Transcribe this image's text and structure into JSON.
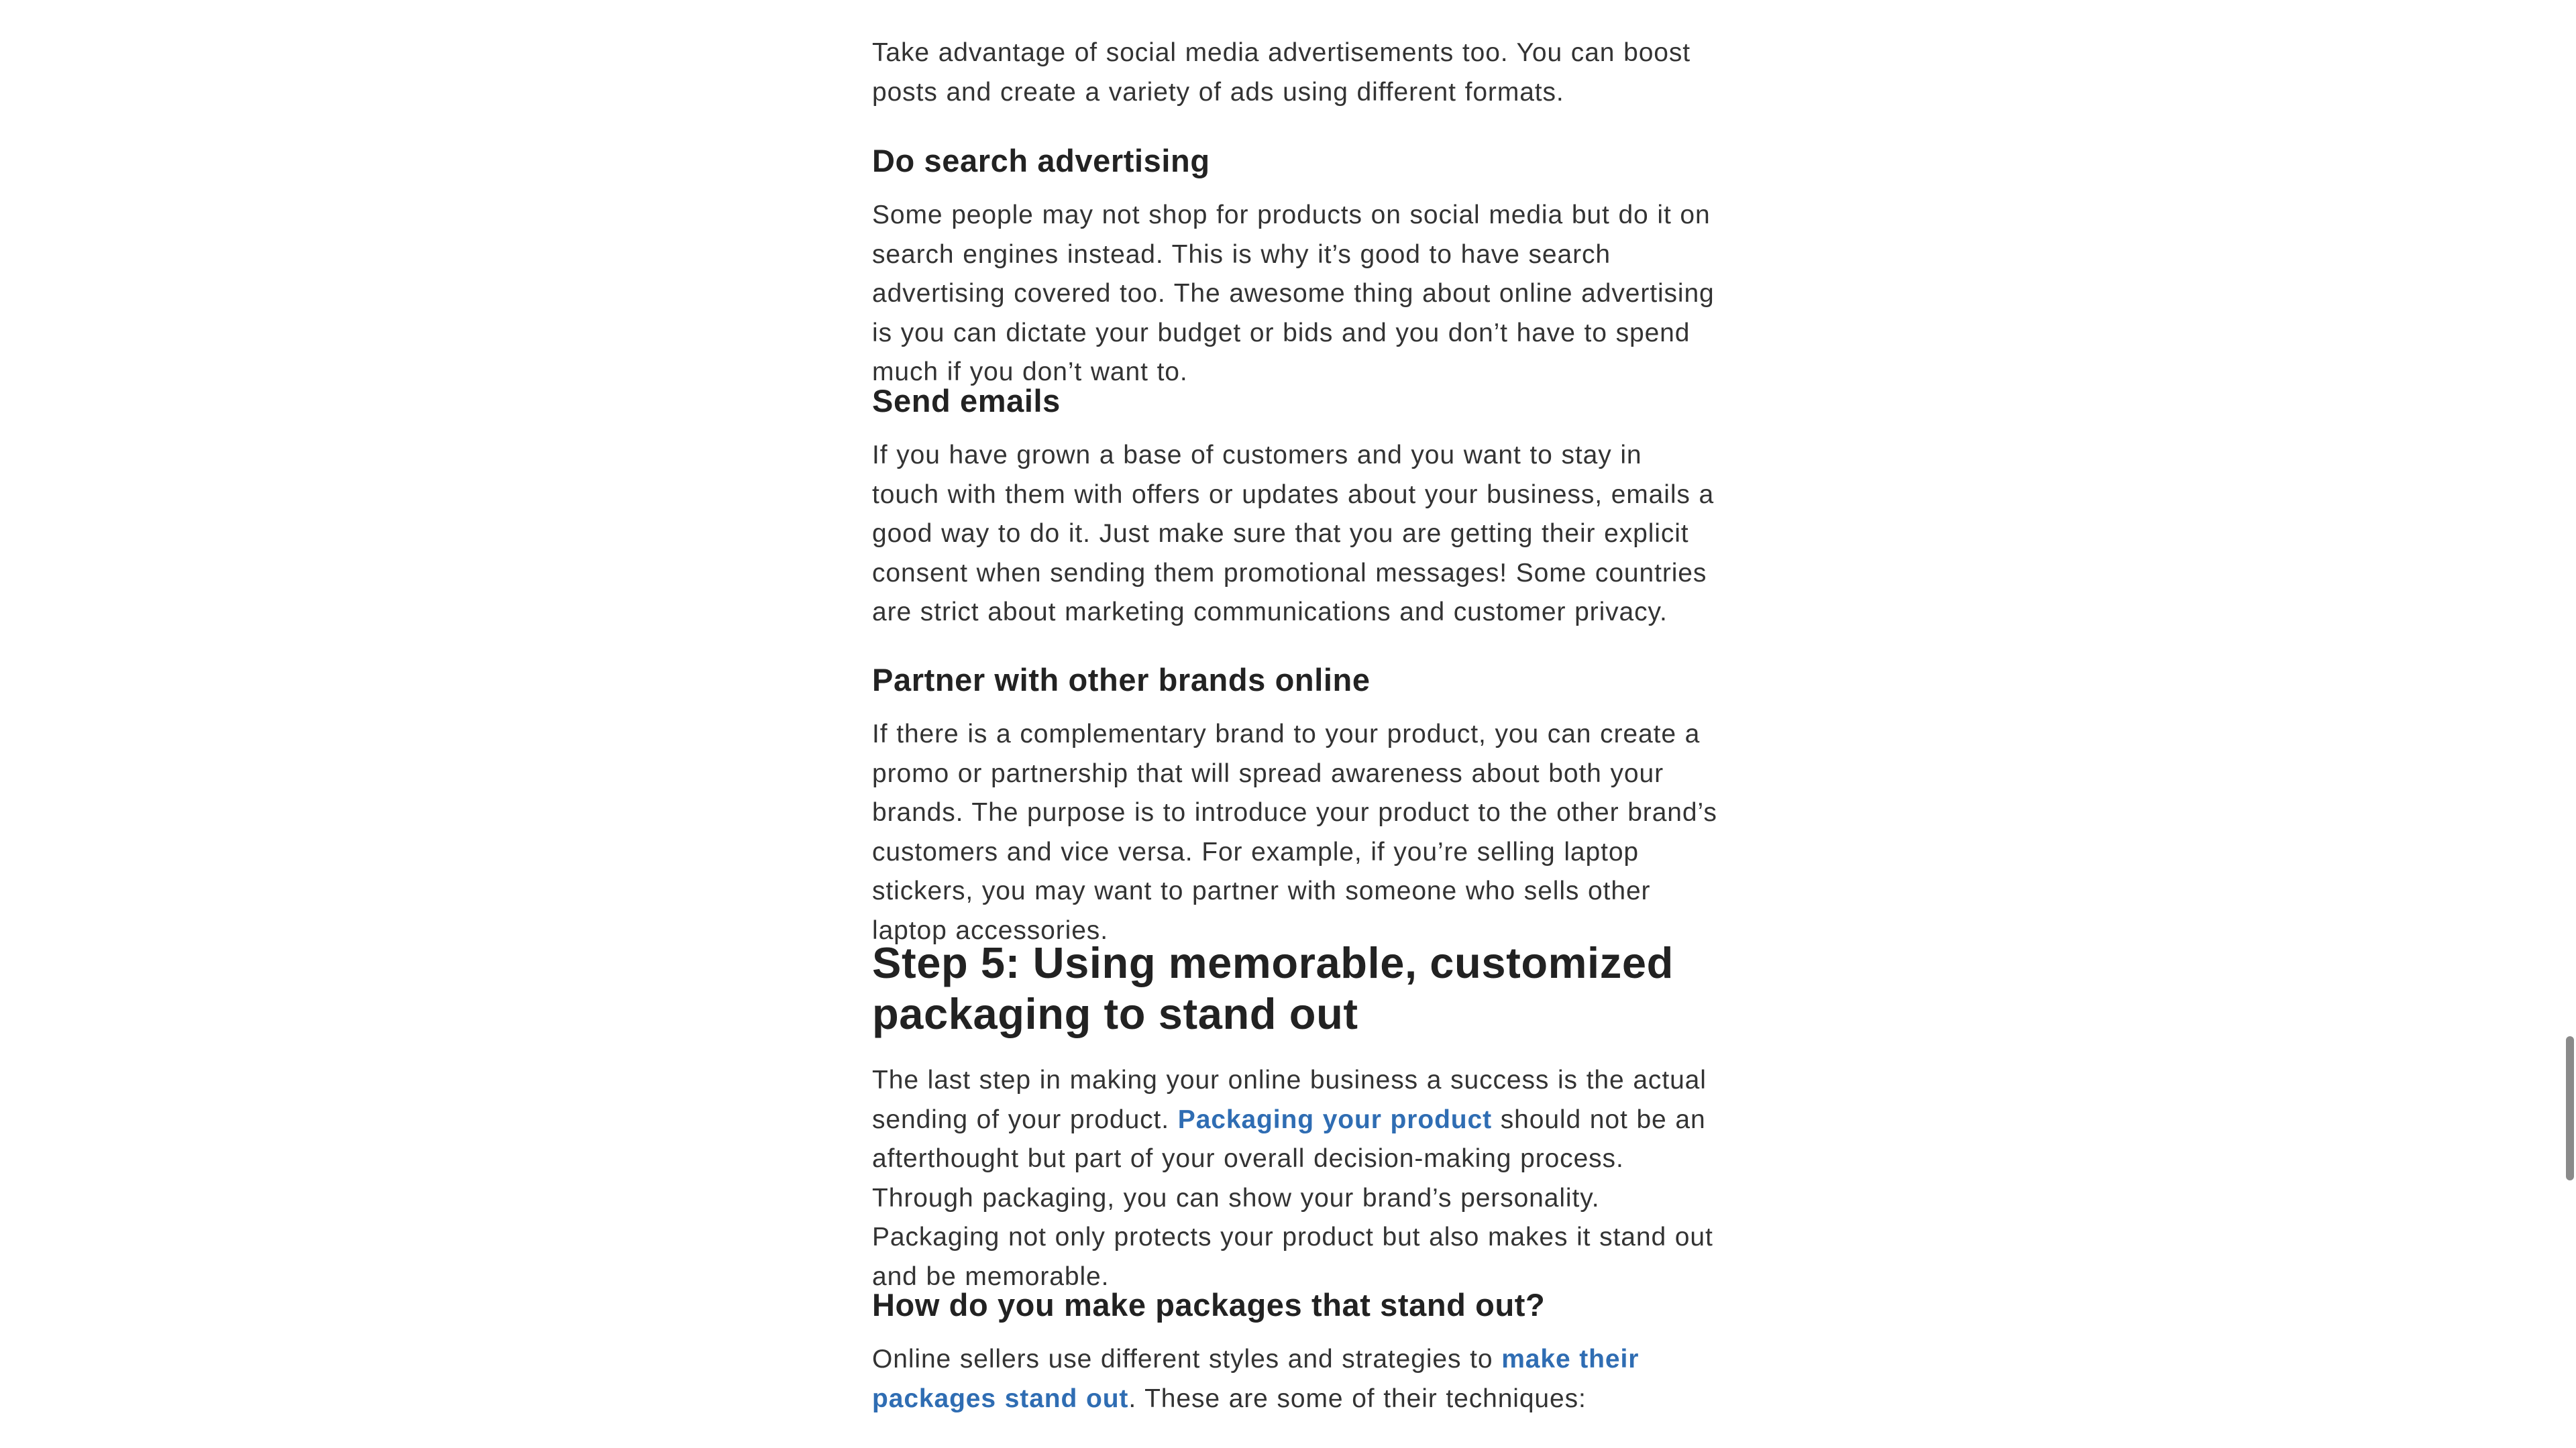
{
  "article": {
    "intro_paragraph": "Take advantage of social media advertisements too. You can boost posts and create a variety of ads using different formats.",
    "sections": {
      "search": {
        "heading": "Do search advertising",
        "body": "Some people may not shop for products on social media but do it on search engines instead. This is why it’s good to have search advertising covered too. The awesome thing about online advertising is you can dictate your budget or bids and you don’t have to spend much if you don’t want to."
      },
      "emails": {
        "heading": "Send emails",
        "body": "If you have grown a base of customers and you want to stay in touch with them with offers or updates about your business, emails a good way to do it. Just make sure that you are getting their explicit consent when sending them promotional messages! Some countries are strict about marketing communications and customer privacy."
      },
      "partner": {
        "heading": "Partner with other brands online",
        "body": "If there is a complementary brand to your product, you can create a promo or partnership that will spread awareness about both your brands. The purpose is to introduce your product to the other brand’s customers and vice versa. For example, if you’re selling laptop stickers, you may want to partner with someone who sells other laptop accessories."
      }
    },
    "step5": {
      "heading": "Step 5: Using memorable, customized packaging to stand out",
      "body_before_link": "The last step in making your online business a success is the actual sending of your product. ",
      "link_text": "Packaging your product",
      "body_after_link": " should not be an afterthought but part of your overall decision-making process. Through packaging, you can show your brand’s personality. Packaging not only protects your product but also makes it stand out and be memorable."
    },
    "packages": {
      "heading": "How do you make packages that stand out?",
      "body_before_link": "Online sellers use different styles and strategies to ",
      "link_text": "make their packages stand out",
      "body_after_link": ". These are some of their techniques:"
    }
  },
  "colors": {
    "link": "#2f6db3",
    "text": "#333333",
    "heading": "#222222",
    "scrollbar": "#8a8a8a"
  }
}
